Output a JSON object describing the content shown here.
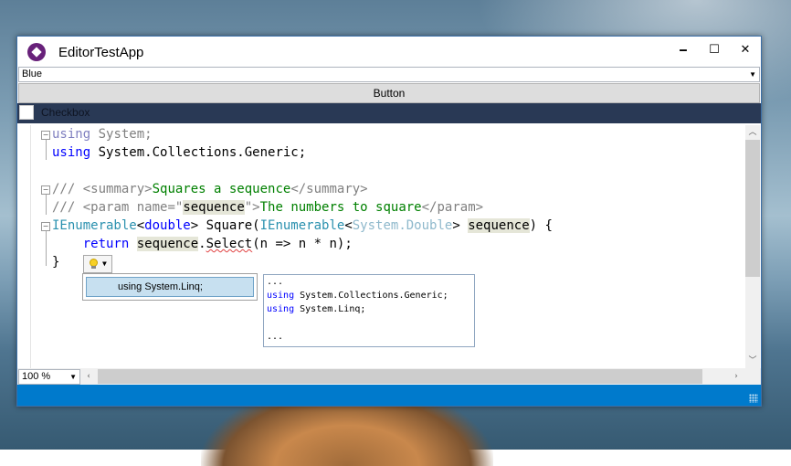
{
  "window": {
    "title": "EditorTestApp"
  },
  "window_buttons": {
    "minimize": "🗕",
    "maximize": "☐",
    "close": "✕"
  },
  "combo": {
    "value": "Blue"
  },
  "button": {
    "label": "Button"
  },
  "checkbox": {
    "label": "Checkbox",
    "checked": false
  },
  "editor": {
    "lines": [
      [
        {
          "t": "using",
          "c": "kwgray"
        },
        {
          "t": " System;",
          "c": "cmgray"
        }
      ],
      [
        {
          "t": "using",
          "c": "kw"
        },
        {
          "t": " System.Collections.Generic;",
          "c": ""
        }
      ],
      [
        {
          "t": "",
          "c": ""
        }
      ],
      [
        {
          "t": "///",
          "c": "cmgray"
        },
        {
          "t": " <summary>",
          "c": "cmgray"
        },
        {
          "t": "Squares a sequence",
          "c": "cm"
        },
        {
          "t": "</summary>",
          "c": "cmgray"
        }
      ],
      [
        {
          "t": "///",
          "c": "cmgray"
        },
        {
          "t": " <param name=\"",
          "c": "cmgray"
        },
        {
          "t": "sequence",
          "c": "hl"
        },
        {
          "t": "\">",
          "c": "cmgray"
        },
        {
          "t": "The numbers to square",
          "c": "cm"
        },
        {
          "t": "</param>",
          "c": "cmgray"
        }
      ],
      [
        {
          "t": "IEnumerable",
          "c": "type"
        },
        {
          "t": "<",
          "c": ""
        },
        {
          "t": "double",
          "c": "kw"
        },
        {
          "t": "> Square(",
          "c": ""
        },
        {
          "t": "IEnumerable",
          "c": "type"
        },
        {
          "t": "<",
          "c": ""
        },
        {
          "t": "System.Double",
          "c": "typegray"
        },
        {
          "t": "> ",
          "c": ""
        },
        {
          "t": "sequence",
          "c": "hl"
        },
        {
          "t": ") {",
          "c": ""
        }
      ],
      [
        {
          "t": "    ",
          "c": ""
        },
        {
          "t": "return",
          "c": "kw"
        },
        {
          "t": " ",
          "c": ""
        },
        {
          "t": "sequence",
          "c": "hl"
        },
        {
          "t": ".",
          "c": ""
        },
        {
          "t": "Select",
          "c": "squig"
        },
        {
          "t": "(n => n * n);",
          "c": ""
        }
      ],
      [
        {
          "t": "}",
          "c": ""
        }
      ]
    ]
  },
  "quick_action": {
    "item": "using System.Linq;"
  },
  "preview": {
    "lines": [
      [
        {
          "t": "...",
          "c": ""
        }
      ],
      [
        {
          "t": "using",
          "c": "kw"
        },
        {
          "t": " System.Collections.Generic;",
          "c": ""
        }
      ],
      [
        {
          "t": "using",
          "c": "kw"
        },
        {
          "t": " System.Linq;",
          "c": ""
        }
      ],
      [
        {
          "t": "",
          "c": ""
        }
      ],
      [
        {
          "t": "...",
          "c": ""
        }
      ]
    ]
  },
  "zoom": {
    "value": "100 %"
  },
  "colors": {
    "status_bar": "#007acc",
    "checkbox_row": "#293955"
  }
}
